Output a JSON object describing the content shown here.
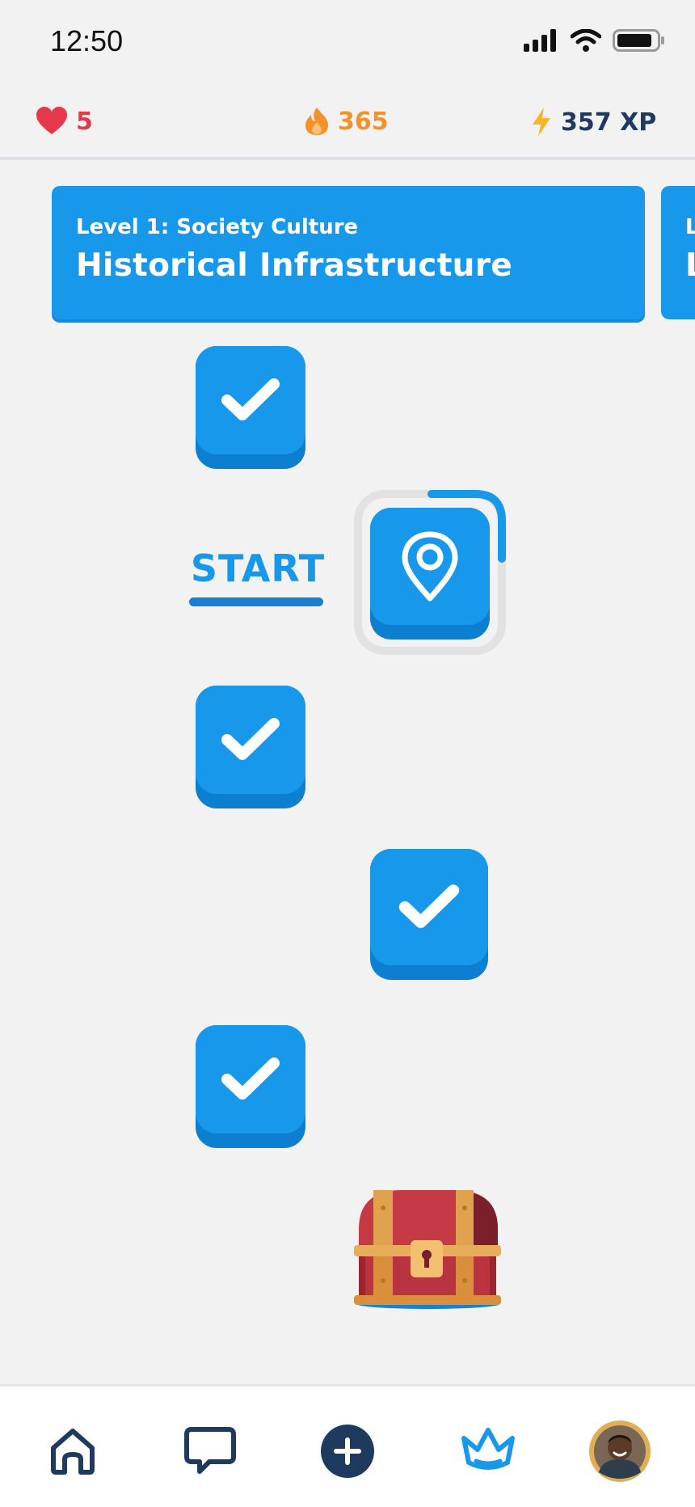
{
  "status_bar": {
    "time": "12:50"
  },
  "stats": {
    "hearts": "5",
    "streak": "365",
    "xp": "357 XP"
  },
  "level_card": {
    "subtitle": "Level 1: Society Culture",
    "title": "Historical Infrastructure"
  },
  "next_level_card": {
    "subtitle": "L",
    "title": "L"
  },
  "path": {
    "start_label": "START",
    "nodes": [
      {
        "status": "completed",
        "icon": "check-icon"
      },
      {
        "status": "current",
        "icon": "map-pin-icon"
      },
      {
        "status": "completed",
        "icon": "check-icon"
      },
      {
        "status": "completed",
        "icon": "check-icon"
      },
      {
        "status": "completed",
        "icon": "check-icon"
      },
      {
        "status": "reward",
        "icon": "treasure-chest-icon"
      }
    ]
  },
  "bottom_nav": [
    {
      "icon": "home-icon"
    },
    {
      "icon": "chat-icon"
    },
    {
      "icon": "add-icon"
    },
    {
      "icon": "crown-icon"
    },
    {
      "icon": "profile-avatar"
    }
  ],
  "colors": {
    "primary": "#1798eb",
    "primary_dark": "#0c7fd0",
    "hearts": "#e5384b",
    "streak": "#f4922a",
    "text_dark": "#1e3a5f",
    "background": "#f2f2f2"
  }
}
